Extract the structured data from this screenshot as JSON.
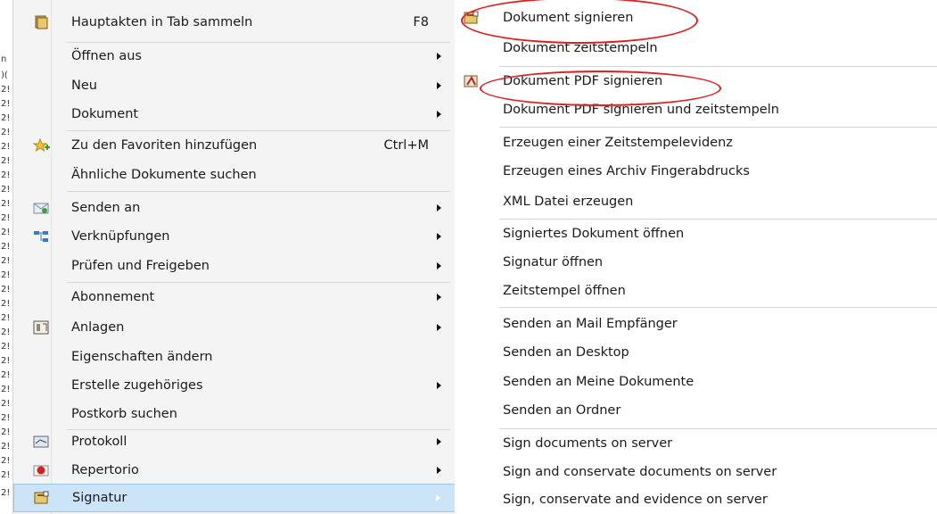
{
  "main_menu": {
    "items": [
      {
        "label": "Hauptakten in Tab sammeln",
        "shortcut": "F8",
        "icon": "folder-stack-icon",
        "submenu": false
      },
      {
        "label": "Öffnen aus",
        "shortcut": "",
        "icon": "",
        "submenu": true
      },
      {
        "label": "Neu",
        "shortcut": "",
        "icon": "",
        "submenu": true
      },
      {
        "label": "Dokument",
        "shortcut": "",
        "icon": "",
        "submenu": true
      },
      {
        "label": "Zu den Favoriten hinzufügen",
        "shortcut": "Ctrl+M",
        "icon": "add-favorite-star-icon",
        "submenu": false
      },
      {
        "label": "Ähnliche Dokumente suchen",
        "shortcut": "",
        "icon": "",
        "submenu": false
      },
      {
        "label": "Senden an",
        "shortcut": "",
        "icon": "send-mail-icon",
        "submenu": true
      },
      {
        "label": "Verknüpfungen",
        "shortcut": "",
        "icon": "links-tree-icon",
        "submenu": true
      },
      {
        "label": "Prüfen und Freigeben",
        "shortcut": "",
        "icon": "",
        "submenu": true
      },
      {
        "label": "Abonnement",
        "shortcut": "",
        "icon": "",
        "submenu": true
      },
      {
        "label": "Anlagen",
        "shortcut": "",
        "icon": "attachments-icon",
        "submenu": true
      },
      {
        "label": "Eigenschaften ändern",
        "shortcut": "",
        "icon": "",
        "submenu": false
      },
      {
        "label": "Erstelle zugehöriges",
        "shortcut": "",
        "icon": "",
        "submenu": true
      },
      {
        "label": "Postkorb suchen",
        "shortcut": "",
        "icon": "",
        "submenu": false
      },
      {
        "label": "Protokoll",
        "shortcut": "",
        "icon": "protocol-icon",
        "submenu": true
      },
      {
        "label": "Repertorio",
        "shortcut": "",
        "icon": "repertorio-icon",
        "submenu": true
      },
      {
        "label": "Signatur",
        "shortcut": "",
        "icon": "signature-icon",
        "submenu": true,
        "active": true
      }
    ]
  },
  "sub_menu": {
    "items": [
      {
        "label": "Dokument signieren",
        "icon": "sign-document-icon"
      },
      {
        "label": "Dokument zeitstempeln",
        "icon": ""
      },
      {
        "label": "Dokument PDF signieren",
        "icon": "sign-pdf-icon"
      },
      {
        "label": "Dokument PDF signieren und zeitstempeln",
        "icon": ""
      },
      {
        "label": "Erzeugen einer Zeitstempelevidenz",
        "icon": ""
      },
      {
        "label": "Erzeugen eines Archiv Fingerabdrucks",
        "icon": ""
      },
      {
        "label": "XML Datei erzeugen",
        "icon": ""
      },
      {
        "label": "Signiertes Dokument öffnen",
        "icon": ""
      },
      {
        "label": "Signatur öffnen",
        "icon": ""
      },
      {
        "label": "Zeitstempel öffnen",
        "icon": ""
      },
      {
        "label": "Senden an Mail Empfänger",
        "icon": ""
      },
      {
        "label": "Senden an Desktop",
        "icon": ""
      },
      {
        "label": "Senden an Meine Dokumente",
        "icon": ""
      },
      {
        "label": "Senden an Ordner",
        "icon": ""
      },
      {
        "label": "Sign documents on server",
        "icon": ""
      },
      {
        "label": "Sign and conservate documents on server",
        "icon": ""
      },
      {
        "label": "Sign, conservate and evidence on server",
        "icon": ""
      }
    ]
  },
  "left_strip": [
    "n",
    ")(",
    "2!",
    "2!",
    "2!",
    "2!",
    "2!",
    "2!",
    "2!",
    "2!",
    "2!",
    "2!",
    "2!",
    "2!",
    "2!",
    "2!",
    "2!",
    "2!",
    "2!",
    "2!",
    "2!",
    "2!",
    "2!",
    "2!",
    "2!",
    "2!",
    "2!",
    "2!",
    "2!",
    "2!",
    "2!"
  ],
  "colors": {
    "active_bg": "#cce4f7",
    "annotation": "#e02020"
  }
}
